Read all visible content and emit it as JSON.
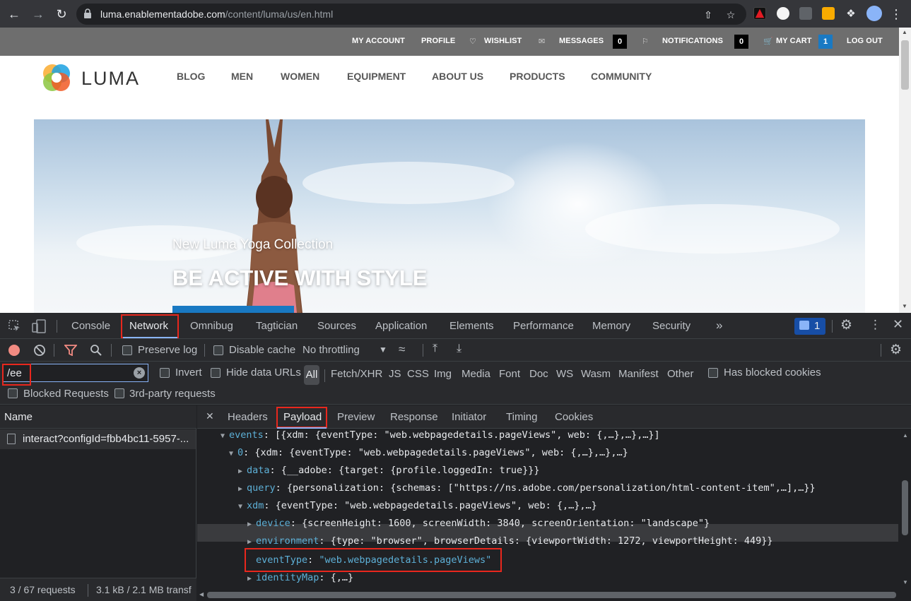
{
  "browser": {
    "url_host": "luma.enablementadobe.com",
    "url_path": "/content/luma/us/en.html",
    "back_icon": "arrow-left-icon",
    "forward_icon": "arrow-right-icon",
    "reload_icon": "reload-icon"
  },
  "site": {
    "header_links": {
      "my_account": "MY ACCOUNT",
      "profile": "PROFILE",
      "wishlist": "WISHLIST",
      "messages": "MESSAGES",
      "messages_count": "0",
      "notifications": "NOTIFICATIONS",
      "notifications_count": "0",
      "my_cart": "MY CART",
      "cart_count": "1",
      "logout": "LOG OUT"
    },
    "logo_text": "LUMA",
    "nav": [
      "BLOG",
      "MEN",
      "WOMEN",
      "EQUIPMENT",
      "ABOUT US",
      "PRODUCTS",
      "COMMUNITY"
    ],
    "hero": {
      "subtitle": "New Luma Yoga Collection",
      "title": "BE ACTIVE WITH STYLE"
    },
    "colors": {
      "header_bg": "#6e6e6e",
      "cart_badge": "#1979c3",
      "accent": "#1979c3"
    }
  },
  "devtools": {
    "tabs": [
      "Console",
      "Network",
      "Omnibug",
      "Tagtician",
      "Sources",
      "Application",
      "Elements",
      "Performance",
      "Memory",
      "Security"
    ],
    "active_tab": "Network",
    "issues_count": "1",
    "toolbar": {
      "preserve_log": "Preserve log",
      "disable_cache": "Disable cache",
      "throttling": "No throttling"
    },
    "filter": {
      "value": "/ee",
      "invert": "Invert",
      "hide_data_urls": "Hide data URLs",
      "types": [
        "All",
        "Fetch/XHR",
        "JS",
        "CSS",
        "Img",
        "Media",
        "Font",
        "Doc",
        "WS",
        "Wasm",
        "Manifest",
        "Other"
      ],
      "has_blocked_cookies": "Has blocked cookies",
      "blocked_requests": "Blocked Requests",
      "third_party": "3rd-party requests"
    },
    "requests": {
      "column_name": "Name",
      "items": [
        "interact?configId=fbb4bc11-5957-..."
      ],
      "footer_count": "3 / 67 requests",
      "footer_size": "3.1 kB / 2.1 MB transf"
    },
    "detail_tabs": [
      "Headers",
      "Payload",
      "Preview",
      "Response",
      "Initiator",
      "Timing",
      "Cookies"
    ],
    "active_detail_tab": "Payload",
    "payload": {
      "l1_key": "events",
      "l1_rest": ": [{xdm: {eventType: \"web.webpagedetails.pageViews\", web: {,…},…},…}]",
      "l2_key": "0",
      "l2_rest": ": {xdm: {eventType: \"web.webpagedetails.pageViews\", web: {,…},…},…}",
      "l3_key": "data",
      "l3_rest": ": {__adobe: {target: {profile.loggedIn: true}}}",
      "l4_key": "query",
      "l4_rest": ": {personalization: {schemas: [\"https://ns.adobe.com/personalization/html-content-item\",…],…}}",
      "l5_key": "xdm",
      "l5_rest": ": {eventType: \"web.webpagedetails.pageViews\", web: {,…},…}",
      "l6_key": "device",
      "l6_rest": ": {screenHeight: 1600, screenWidth: 3840, screenOrientation: \"landscape\"}",
      "l7_key": "environment",
      "l7_rest": ": {type: \"browser\", browserDetails: {viewportWidth: 1272, viewportHeight: 449}}",
      "l8_key": "eventType",
      "l8_sep": ": ",
      "l8_val": "\"web.webpagedetails.pageViews\"",
      "l9_key": "identityMap",
      "l9_rest": ": {,…}"
    }
  }
}
